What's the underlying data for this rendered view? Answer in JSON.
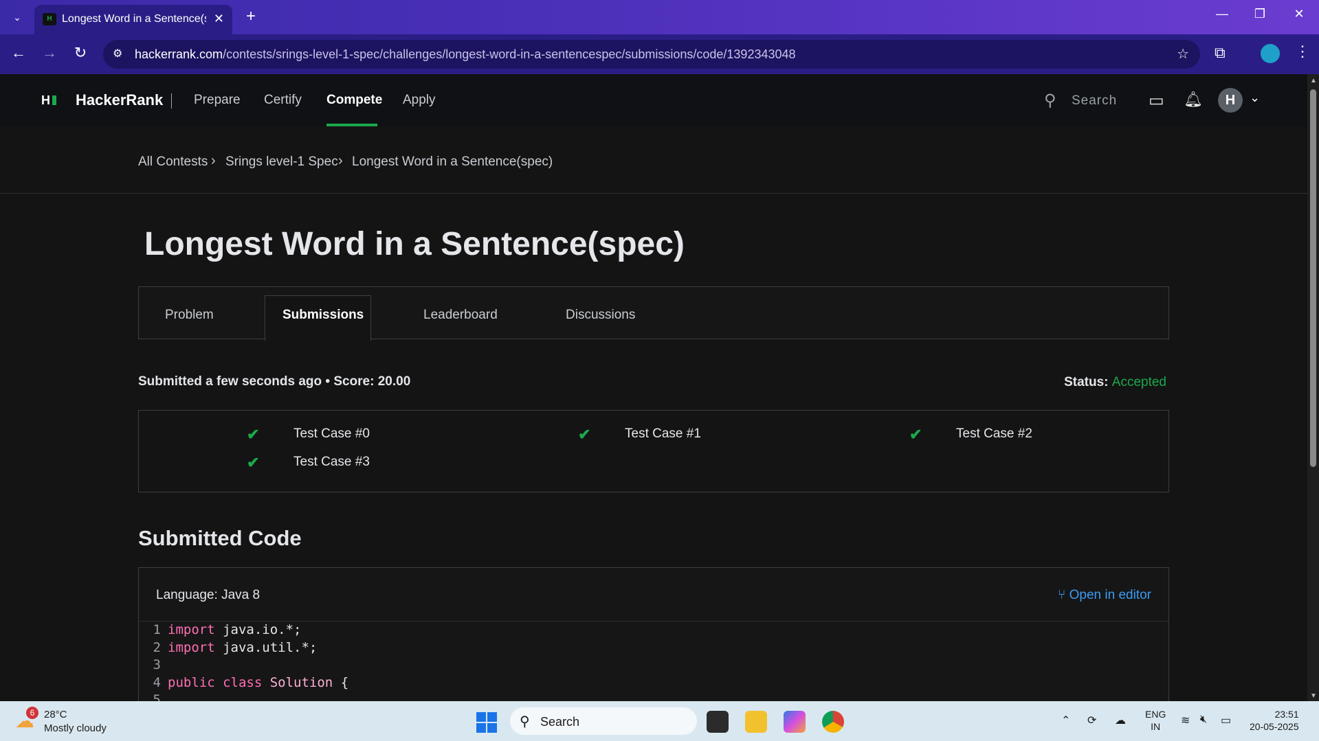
{
  "browser": {
    "tab_title": "Longest Word in a Sentence(spec)",
    "url_host": "hackerrank.com",
    "url_path": "/contests/srings-level-1-spec/challenges/longest-word-in-a-sentencespec/submissions/code/1392343048"
  },
  "nav": {
    "brand": "HackerRank",
    "links": [
      "Prepare",
      "Certify",
      "Compete",
      "Apply"
    ],
    "active": "Compete",
    "search_placeholder": "Search",
    "avatar_initial": "H",
    "accent": "#1ba94c"
  },
  "breadcrumb": [
    "All Contests",
    "Srings level-1 Spec",
    "Longest Word in a Sentence(spec)"
  ],
  "page": {
    "title": "Longest Word in a Sentence(spec)",
    "tabs": [
      "Problem",
      "Submissions",
      "Leaderboard",
      "Discussions"
    ],
    "active_tab": "Submissions"
  },
  "submission": {
    "summary": "Submitted a few seconds ago • Score: 20.00",
    "status_label": "Status:",
    "status_value": "Accepted",
    "test_cases": [
      "Test Case #0",
      "Test Case #1",
      "Test Case #2",
      "Test Case #3"
    ]
  },
  "code": {
    "section_title": "Submitted Code",
    "language": "Language: Java 8",
    "open_in_editor": "Open in editor",
    "lines": [
      {
        "n": "1",
        "kw": "import",
        "rest": " java.io.*;"
      },
      {
        "n": "2",
        "kw": "import",
        "rest": " java.util.*;"
      },
      {
        "n": "3",
        "kw": "",
        "rest": ""
      },
      {
        "n": "4",
        "kw": "public class",
        "cls": "Solution",
        "rest": " {"
      },
      {
        "n": "5",
        "kw": "",
        "rest": ""
      }
    ]
  },
  "taskbar": {
    "weather_badge": "6",
    "temperature": "28°C",
    "weather": "Mostly cloudy",
    "search": "Search",
    "lang_line1": "ENG",
    "lang_line2": "IN",
    "time": "23:51",
    "date": "20-05-2025"
  }
}
